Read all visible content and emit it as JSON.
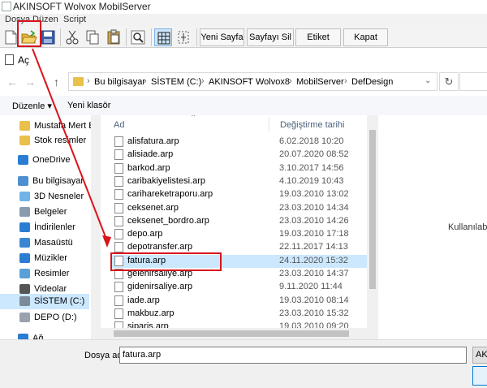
{
  "app": {
    "title": "AKINSOFT Wolvox MobilServer"
  },
  "menu": [
    "Dosya",
    "Düzen",
    "Script"
  ],
  "toolbar": {
    "icons": [
      "new-file-icon",
      "open-folder-icon",
      "save-icon",
      "cut-icon",
      "copy-icon",
      "paste-icon",
      "zoom-icon",
      "grid-icon",
      "align-icon"
    ],
    "new_page": "Yeni Sayfa",
    "delete_page": "Sayfayı Sil",
    "label_settings": "Etiket Ayarla",
    "close": "Kapat"
  },
  "dialog": {
    "title": "Aç",
    "breadcrumb": [
      "Bu bilgisayar",
      "SİSTEM (C:)",
      "AKINSOFT",
      "Wolvox8",
      "MobilServer",
      "DefDesign"
    ],
    "commands": {
      "organize": "Düzenle ▾",
      "new_folder": "Yeni klasör"
    },
    "nav": [
      {
        "label": "Mustafa Mert BA",
        "icon": "folder-icon",
        "color": "#e8c04a"
      },
      {
        "label": "Stok resimler",
        "icon": "folder-icon",
        "color": "#e8c04a"
      },
      {
        "label": "OneDrive",
        "icon": "cloud-icon",
        "color": "#2b7cd3"
      },
      {
        "label": "Bu bilgisayar",
        "icon": "computer-icon",
        "color": "#4d8fd1"
      },
      {
        "label": "3D Nesneler",
        "icon": "cube-icon",
        "color": "#6fb3e8"
      },
      {
        "label": "Belgeler",
        "icon": "documents-icon",
        "color": "#8a9bb0"
      },
      {
        "label": "İndirilenler",
        "icon": "download-icon",
        "color": "#2b7cd3"
      },
      {
        "label": "Masaüstü",
        "icon": "desktop-icon",
        "color": "#3a86d4"
      },
      {
        "label": "Müzikler",
        "icon": "music-icon",
        "color": "#2b7cd3"
      },
      {
        "label": "Resimler",
        "icon": "pictures-icon",
        "color": "#5aa0d8"
      },
      {
        "label": "Videolar",
        "icon": "video-icon",
        "color": "#555555"
      },
      {
        "label": "SİSTEM (C:)",
        "icon": "drive-icon",
        "color": "#7a8a99"
      },
      {
        "label": "DEPO (D:)",
        "icon": "drive-icon",
        "color": "#9aa3ad"
      },
      {
        "label": "Ağ",
        "icon": "network-icon",
        "color": "#2b7cd3"
      }
    ],
    "columns": {
      "name": "Ad",
      "date": "Değiştirme tarihi"
    },
    "files": [
      {
        "name": "alisfatura.arp",
        "date": "6.02.2018 10:20"
      },
      {
        "name": "alisiade.arp",
        "date": "20.07.2020 08:52"
      },
      {
        "name": "barkod.arp",
        "date": "3.10.2017 14:56"
      },
      {
        "name": "caribakiyelistesi.arp",
        "date": "4.10.2019 10:43"
      },
      {
        "name": "carihareketraporu.arp",
        "date": "19.03.2010 13:02"
      },
      {
        "name": "ceksenet.arp",
        "date": "23.03.2010 14:34"
      },
      {
        "name": "ceksenet_bordro.arp",
        "date": "23.03.2010 14:26"
      },
      {
        "name": "depo.arp",
        "date": "19.03.2010 17:18"
      },
      {
        "name": "depotransfer.arp",
        "date": "22.11.2017 14:13"
      },
      {
        "name": "fatura.arp",
        "date": "24.11.2020 15:32"
      },
      {
        "name": "gelenirsaliye.arp",
        "date": "23.03.2010 14:37"
      },
      {
        "name": "gidenirsaliye.arp",
        "date": "9.11.2020 11:44"
      },
      {
        "name": "iade.arp",
        "date": "19.03.2010 08:14"
      },
      {
        "name": "makbuz.arp",
        "date": "23.03.2010 15:32"
      },
      {
        "name": "siparis.arp",
        "date": "19.03.2010 09:20"
      }
    ],
    "preview_text": "Kullanılabi",
    "file_name_label": "Dosya adı:",
    "file_name_value": "fatura.arp",
    "file_type": "AKI",
    "highlight_color": "#d9141b"
  }
}
